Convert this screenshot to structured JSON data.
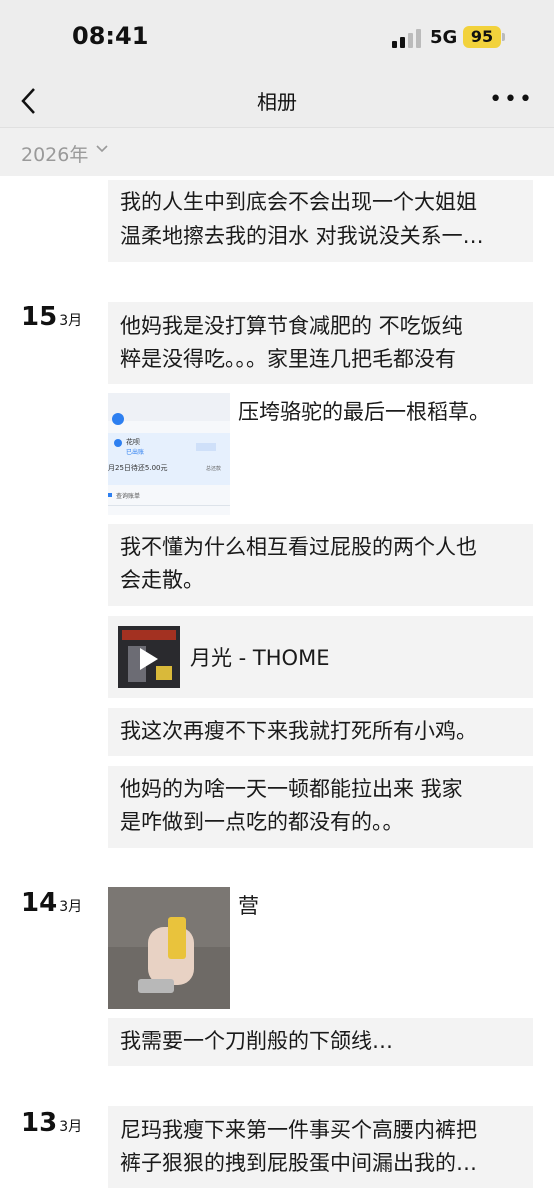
{
  "status": {
    "time": "08:41",
    "network": "5G",
    "battery": "95"
  },
  "nav": {
    "title": "相册",
    "more": "•••"
  },
  "year_filter": {
    "label": "2026年"
  },
  "entries": {
    "top": {
      "text1": "我的人生中到底会不会出现一个大姐姐",
      "text2": "温柔地擦去我的泪水 对我说没关系一…"
    },
    "d15": {
      "day": "15",
      "month": "3月",
      "p1_line1": "他妈我是没打算节食减肥的 不吃饭纯",
      "p1_line2": "粹是没得吃。。。家里连几把毛都没有",
      "img_caption": "压垮骆驼的最后一根稻草。",
      "shot": {
        "app": "花呗",
        "tag": "已出账",
        "bill": "月25日待还5.00元",
        "sub": "总还款",
        "link": "查询账单"
      },
      "p2_line1": "我不懂为什么相互看过屁股的两个人也",
      "p2_line2": "会走散。",
      "music": "月光 - THOME",
      "p3": "我这次再瘦不下来我就打死所有小鸡。",
      "p4_line1": "他妈的为啥一天一顿都能拉出来 我家",
      "p4_line2": "是咋做到一点吃的都没有的。。"
    },
    "d14": {
      "day": "14",
      "month": "3月",
      "img_caption": "营",
      "p1": "我需要一个刀削般的下颌线…"
    },
    "d13": {
      "day": "13",
      "month": "3月",
      "p1_line1": "尼玛我瘦下来第一件事买个高腰内裤把",
      "p1_line2": "裤子狠狠的拽到屁股蛋中间漏出我的…"
    }
  },
  "colors": {
    "nav_bg": "#ededed",
    "card_bg": "#f3f3f3",
    "battery": "#f2d23c"
  }
}
